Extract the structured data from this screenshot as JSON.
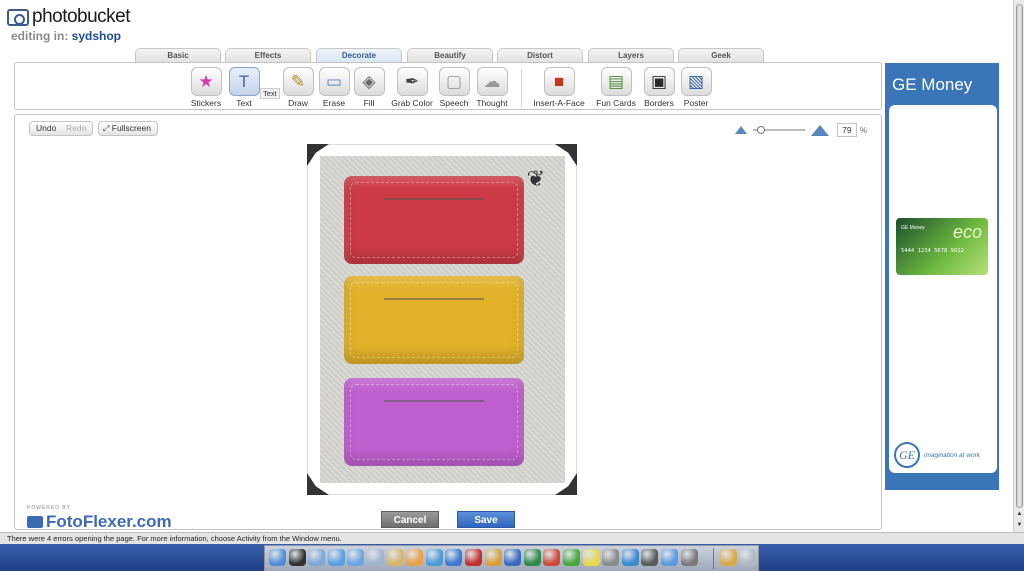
{
  "header": {
    "logo_text": "photobucket",
    "editing_prefix": "editing in:",
    "editing_user": "sydshop"
  },
  "tabs": [
    {
      "label": "Basic",
      "active": false
    },
    {
      "label": "Effects",
      "active": false
    },
    {
      "label": "Decorate",
      "active": true
    },
    {
      "label": "Beautify",
      "active": false
    },
    {
      "label": "Distort",
      "active": false
    },
    {
      "label": "Layers",
      "active": false
    },
    {
      "label": "Geek",
      "active": false
    }
  ],
  "tools": [
    {
      "label": "Stickers",
      "icon": "stickers-icon",
      "glyph": "★",
      "color": "#d63bb0"
    },
    {
      "label": "Text",
      "icon": "text-icon",
      "glyph": "T",
      "color": "#4a6a9a"
    },
    {
      "label": "Draw",
      "icon": "pencil-icon",
      "glyph": "✎",
      "color": "#b38a2a"
    },
    {
      "label": "Erase",
      "icon": "eraser-icon",
      "glyph": "▭",
      "color": "#5a86c0"
    },
    {
      "label": "Fill",
      "icon": "fill-bucket-icon",
      "glyph": "◈",
      "color": "#666666"
    },
    {
      "label": "Grab Color",
      "icon": "eyedropper-icon",
      "glyph": "✒",
      "color": "#444444"
    },
    {
      "label": "Speech",
      "icon": "speech-bubble-icon",
      "glyph": "▢",
      "color": "#999999"
    },
    {
      "label": "Thought",
      "icon": "thought-bubble-icon",
      "glyph": "☁",
      "color": "#999999"
    },
    {
      "label": "Insert-A-Face",
      "icon": "face-icon",
      "glyph": "■",
      "color": "#c4361e"
    },
    {
      "label": "Fun Cards",
      "icon": "fun-cards-icon",
      "glyph": "▤",
      "color": "#4a8a3a"
    },
    {
      "label": "Borders",
      "icon": "borders-icon",
      "glyph": "▣",
      "color": "#2a2a2a"
    },
    {
      "label": "Poster",
      "icon": "poster-icon",
      "glyph": "▧",
      "color": "#2a5a9a"
    }
  ],
  "text_tooltip": "Text",
  "canvas": {
    "undo_label": "Undo",
    "redo_label": "Redo",
    "fullscreen_label": "Fullscreen",
    "zoom_value": "79",
    "zoom_unit": "%",
    "zoom_fraction": 0.1
  },
  "photo": {
    "wallet_colors": [
      "#cc3a46",
      "#e2b22a",
      "#c060d0"
    ]
  },
  "brand": {
    "powered_by": "POWERED BY",
    "name": "FotoFlexer.com"
  },
  "actions": {
    "cancel_label": "Cancel",
    "save_label": "Save"
  },
  "ad": {
    "title": "GE Money",
    "card_brand": "GE Money",
    "card_eco": "eco",
    "card_number": "5444 1234 5678 9012",
    "ge_logo": "GE",
    "tagline": "imagination at work"
  },
  "status": {
    "message": "There were 4 errors opening the page. For more information, choose Activity from the Window menu."
  },
  "dock_icons": [
    {
      "name": "finder-icon",
      "color": "#4f8fd9"
    },
    {
      "name": "dashboard-icon",
      "color": "#333333"
    },
    {
      "name": "mail-icon",
      "color": "#7fa8d8"
    },
    {
      "name": "safari-icon",
      "color": "#5aa0e0"
    },
    {
      "name": "itunes-icon",
      "color": "#6aa6e0"
    },
    {
      "name": "ichat-icon",
      "color": "#9fb4cc"
    },
    {
      "name": "preview-icon",
      "color": "#d8b46a"
    },
    {
      "name": "address-book-icon",
      "color": "#e8a04a"
    },
    {
      "name": "iphoto-icon",
      "color": "#4a9ad8"
    },
    {
      "name": "imovie-icon",
      "color": "#3b7ad0"
    },
    {
      "name": "idvd-icon",
      "color": "#c42e2e"
    },
    {
      "name": "garageband-icon",
      "color": "#d8a03a"
    },
    {
      "name": "iweb-icon",
      "color": "#3a6ac0"
    },
    {
      "name": "finder-app-icon",
      "color": "#2e8a4a"
    },
    {
      "name": "calendar-icon",
      "color": "#d04a3a"
    },
    {
      "name": "limewire-icon",
      "color": "#48a838"
    },
    {
      "name": "stickies-icon",
      "color": "#e8d84a"
    },
    {
      "name": "system-prefs-icon",
      "color": "#8a8a8a"
    },
    {
      "name": "network-icon",
      "color": "#3a8ad0"
    },
    {
      "name": "photo-booth-icon",
      "color": "#5a5a5a"
    },
    {
      "name": "app-store-icon",
      "color": "#5a9ae0"
    },
    {
      "name": "chess-icon",
      "color": "#7a7a7a"
    },
    {
      "name": "image-capture-icon",
      "color": "#d8a84a"
    },
    {
      "name": "trash-icon",
      "color": "#b0b8c4"
    }
  ]
}
